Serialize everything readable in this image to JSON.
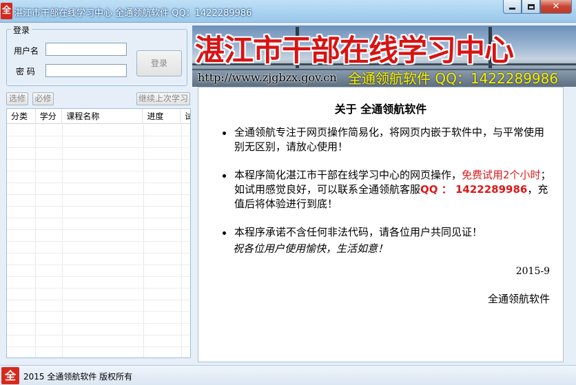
{
  "window": {
    "icon_glyph": "全",
    "title": "湛江市干部在线学习中心 全通领航软件 QQ：1422289986",
    "controls": [
      "minimize-icon",
      "maximize-icon",
      "close-icon"
    ]
  },
  "login": {
    "group_label": "登录",
    "username_label": "用户名",
    "password_label": "密 码",
    "username_value": "",
    "password_value": "",
    "login_button": "登录"
  },
  "course_buttons": {
    "elective": "选修",
    "required": "必修",
    "continue": "继续上次学习"
  },
  "course_table": {
    "columns": [
      "分类",
      "学分",
      "课程名称",
      "进度",
      "试"
    ],
    "rows": []
  },
  "banner": {
    "title": "湛江市干部在线学习中心",
    "url": "http://www.zjgbzx.gov.cn",
    "promo": "全通领航软件 QQ：1422289986"
  },
  "about": {
    "title": "关于 全通领航软件",
    "bullet1": "全通领航专注于网页操作简易化，将网页内嵌于软件中，与平常使用别无区别，请放心使用！",
    "bullet2_a": "本程序简化湛江市干部在线学习中心的网页操作，",
    "bullet2_red": "免费试用2个小时",
    "bullet2_b": "；如试用感觉良好，可以联系全通领航客服",
    "bullet2_qq": "QQ ： 1422289986",
    "bullet2_c": "，充值后将体验进行到底！",
    "bullet3": "本程序承诺不含任何非法代码，请各位用户共同见证！",
    "wish": "祝各位用户使用愉快，生活如意！",
    "date": "2015-9",
    "company": "全通领航软件"
  },
  "statusbar": {
    "icon_glyph": "全",
    "text": "2015 全通领航软件 版权所有"
  },
  "colors": {
    "accent_red": "#e0161a",
    "titlebar": "#a8d1ef",
    "window_bg": "#e6eff8"
  }
}
